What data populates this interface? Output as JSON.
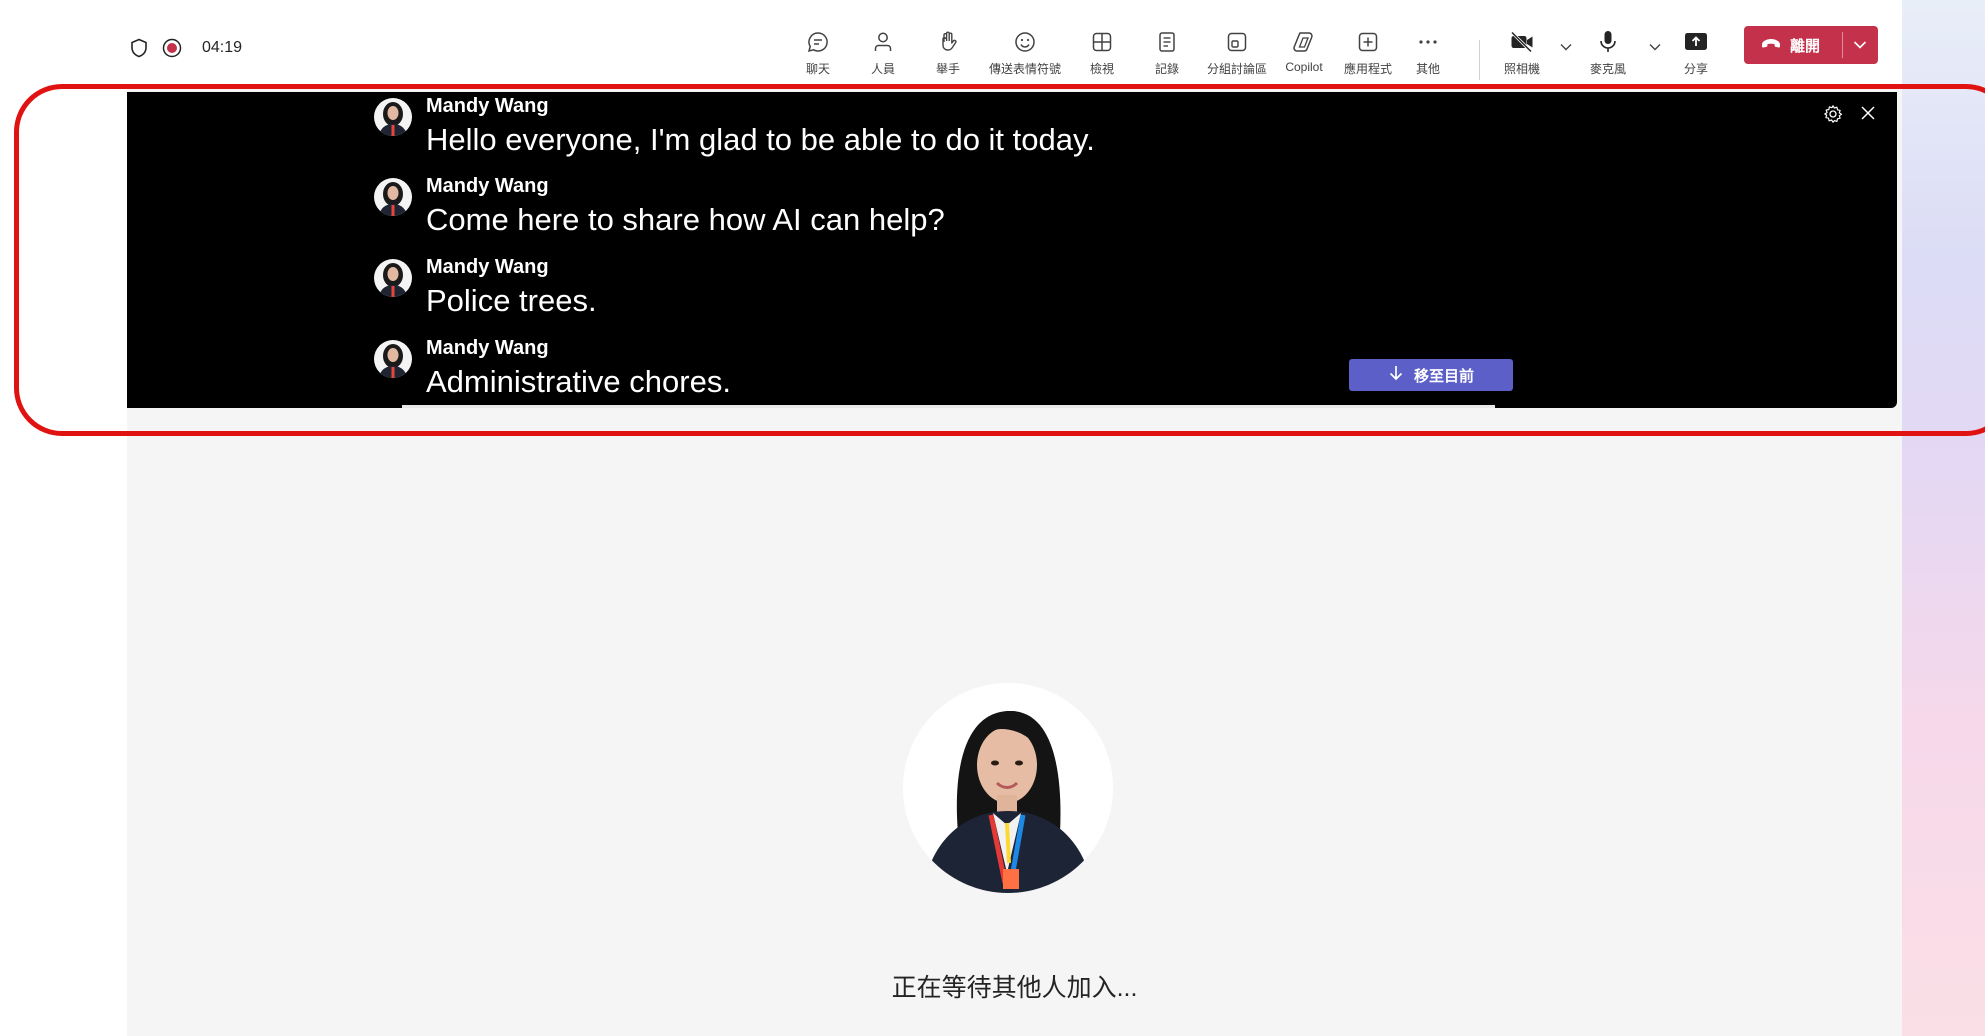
{
  "status": {
    "shield_icon": "shield-icon",
    "recording_icon": "recording-dot-icon",
    "timer": "04:19"
  },
  "toolbar": {
    "items": [
      {
        "label": "聊天",
        "icon": "chat-icon"
      },
      {
        "label": "人員",
        "icon": "people-icon"
      },
      {
        "label": "舉手",
        "icon": "raise-hand-icon"
      },
      {
        "label": "傳送表情符號",
        "icon": "emoji-icon"
      },
      {
        "label": "檢視",
        "icon": "view-grid-icon"
      },
      {
        "label": "記錄",
        "icon": "notes-icon"
      },
      {
        "label": "分組討論區",
        "icon": "breakout-rooms-icon"
      },
      {
        "label": "Copilot",
        "icon": "copilot-icon"
      },
      {
        "label": "應用程式",
        "icon": "apps-icon"
      },
      {
        "label": "其他",
        "icon": "more-icon"
      }
    ],
    "camera_label": "照相機",
    "mic_label": "麥克風",
    "share_label": "分享",
    "leave_label": "離開"
  },
  "captions": {
    "lines": [
      {
        "speaker": "Mandy Wang",
        "text": "Hello everyone, I'm glad to be able to do it today."
      },
      {
        "speaker": "Mandy Wang",
        "text": "Come here to share how AI can help?"
      },
      {
        "speaker": "Mandy Wang",
        "text": "Police trees."
      },
      {
        "speaker": "Mandy Wang",
        "text": "Administrative chores."
      }
    ],
    "jump_label": "移至目前"
  },
  "stage": {
    "waiting_text": "正在等待其他人加入..."
  },
  "colors": {
    "leave": "#c4314b",
    "jump": "#5b5fc7",
    "highlight": "#e11212"
  }
}
